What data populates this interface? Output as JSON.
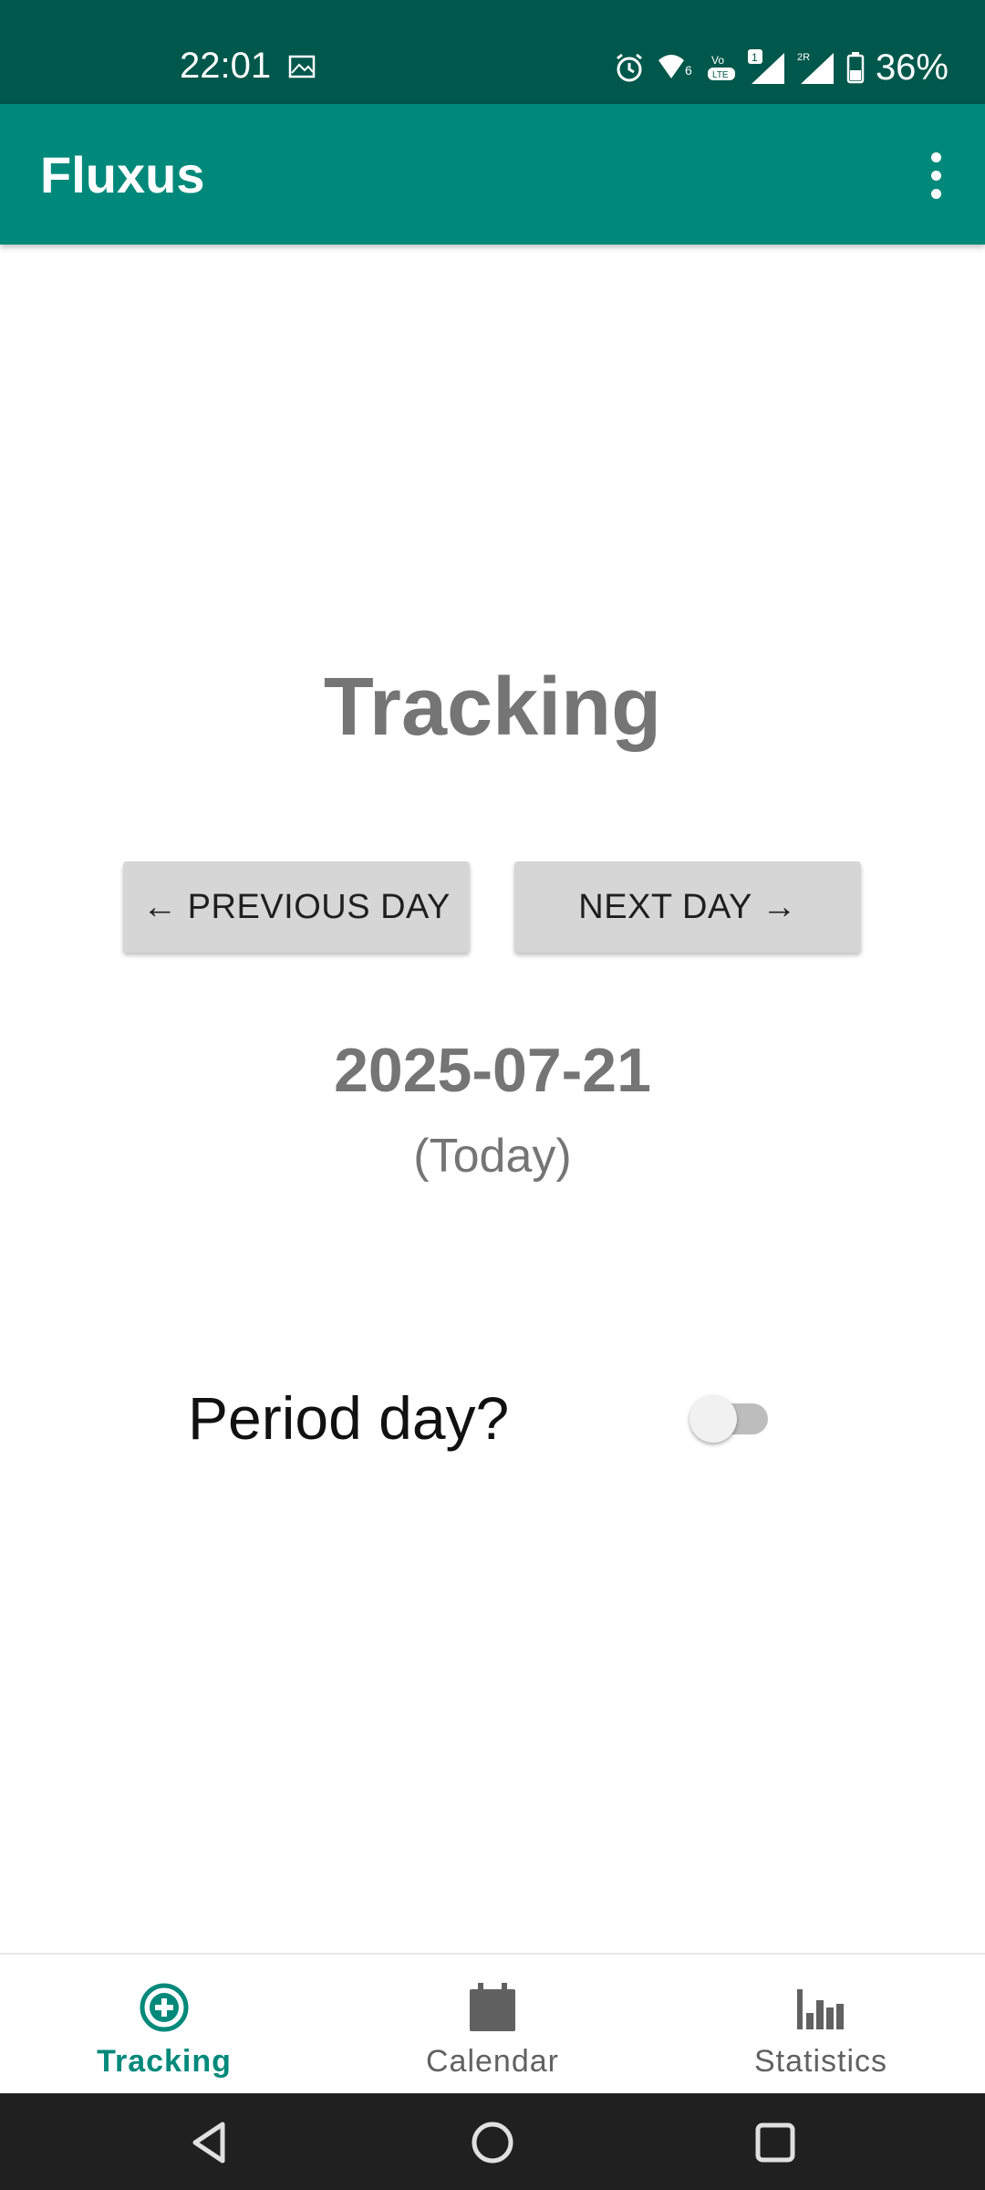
{
  "status_bar": {
    "time": "22:01",
    "battery": "36%"
  },
  "app_bar": {
    "title": "Fluxus",
    "overflow_icon": "more-vert-icon"
  },
  "main": {
    "title": "Tracking",
    "prev_label": "← PREVIOUS DAY",
    "next_label": "NEXT DAY →",
    "date": "2025-07-21",
    "date_note": "(Today)",
    "period_label": "Period day?",
    "period_toggle_on": false
  },
  "bottom_nav": {
    "items": [
      {
        "label": "Tracking",
        "icon": "add-circle-icon",
        "active": true
      },
      {
        "label": "Calendar",
        "icon": "calendar-icon",
        "active": false
      },
      {
        "label": "Statistics",
        "icon": "bar-chart-icon",
        "active": false
      }
    ]
  },
  "colors": {
    "primary": "#00897b",
    "primary_dark": "#00574b",
    "text_gray": "#757575"
  }
}
